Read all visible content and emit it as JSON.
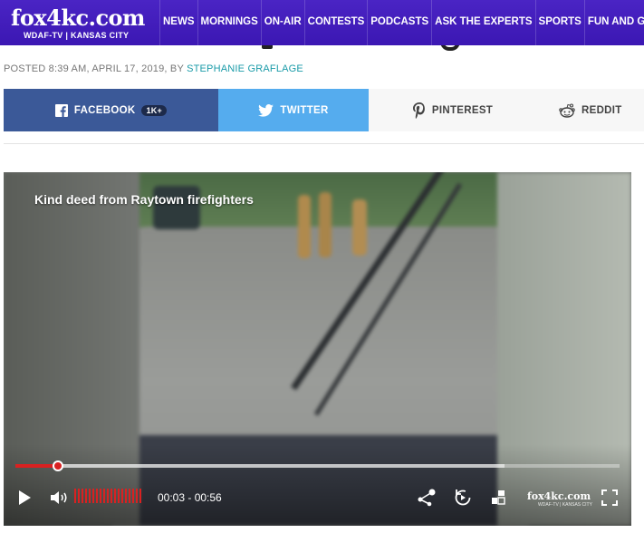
{
  "header": {
    "logo": {
      "main": "fox4kc.com",
      "sub": "WDAF-TV | KANSAS CITY"
    },
    "nav": [
      "NEWS",
      "MORNINGS",
      "ON-AIR",
      "CONTESTS",
      "PODCASTS",
      "ASK THE EXPERTS",
      "SPORTS",
      "FUN AND GA"
    ]
  },
  "article": {
    "posted": "POSTED 8:39 AM, APRIL 17, 2019, BY ",
    "author": "STEPHANIE GRAFLAGE"
  },
  "share": {
    "facebook_label": "FACEBOOK",
    "facebook_count": "1K+",
    "twitter_label": "TWITTER",
    "pinterest_label": "PINTEREST",
    "reddit_label": "REDDIT",
    "colors": {
      "facebook": "#3b5998",
      "twitter": "#55acee",
      "neutral": "#f7f7f7"
    }
  },
  "video": {
    "title": "Kind deed from Raytown firefighters",
    "time": "00:03 - 00:56",
    "progress_fraction": 0.07,
    "buffered_fraction": 0.81,
    "volume_fraction": 1.0,
    "brand": "fox4kc.com",
    "brand_sub": "WDAF-TV | KANSAS CITY",
    "accent": "#d92121",
    "icons": [
      "play-icon",
      "volume-icon",
      "share-icon",
      "replay-icon",
      "mini-player-icon",
      "fullscreen-icon"
    ]
  }
}
